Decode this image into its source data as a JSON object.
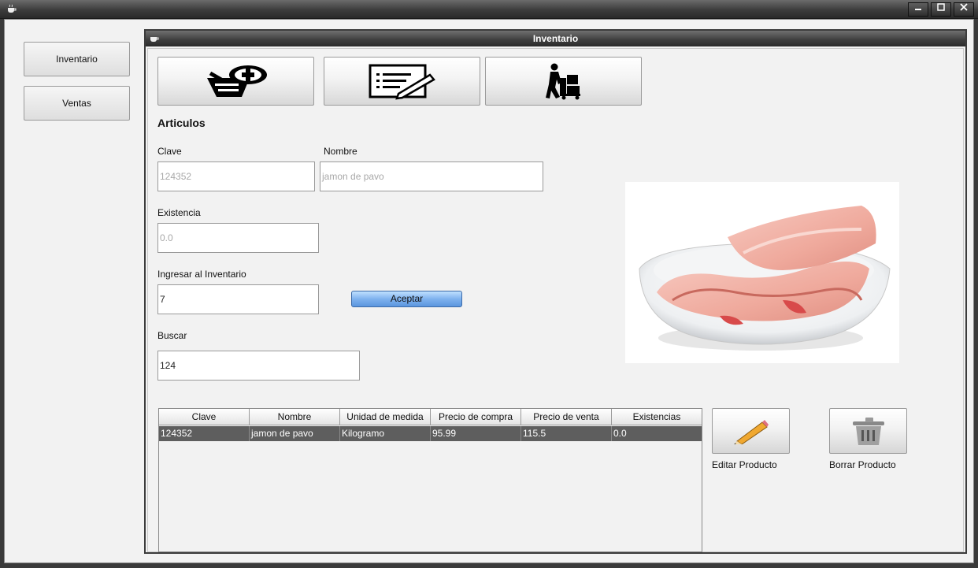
{
  "window": {
    "title": ""
  },
  "nav": {
    "inventario": "Inventario",
    "ventas": "Ventas"
  },
  "frame": {
    "title": "Inventario"
  },
  "toolbar": {
    "icons": [
      "add-product-icon",
      "form-edit-icon",
      "delivery-person-icon"
    ]
  },
  "form": {
    "section_title": "Articulos",
    "clave_label": "Clave",
    "clave_value": "124352",
    "nombre_label": "Nombre",
    "nombre_value": "jamon de pavo",
    "existencia_label": "Existencia",
    "existencia_value": "0.0",
    "ingresar_label": "Ingresar al Inventario",
    "ingresar_value": "7",
    "accept_label": "Aceptar",
    "buscar_label": "Buscar",
    "buscar_value": "124"
  },
  "table": {
    "columns": [
      "Clave",
      "Nombre",
      "Unidad de medida",
      "Precio de compra",
      "Precio de venta",
      "Existencias"
    ],
    "rows": [
      [
        "124352",
        "jamon de pavo",
        "Kilogramo",
        "95.99",
        "115.5",
        "0.0"
      ]
    ]
  },
  "actions": {
    "edit_label": "Editar Producto",
    "delete_label": "Borrar Producto"
  },
  "colors": {
    "accent": "#6ea5ea",
    "selected_row": "#5e5e5e",
    "titlebar": "#3c3c3c"
  }
}
